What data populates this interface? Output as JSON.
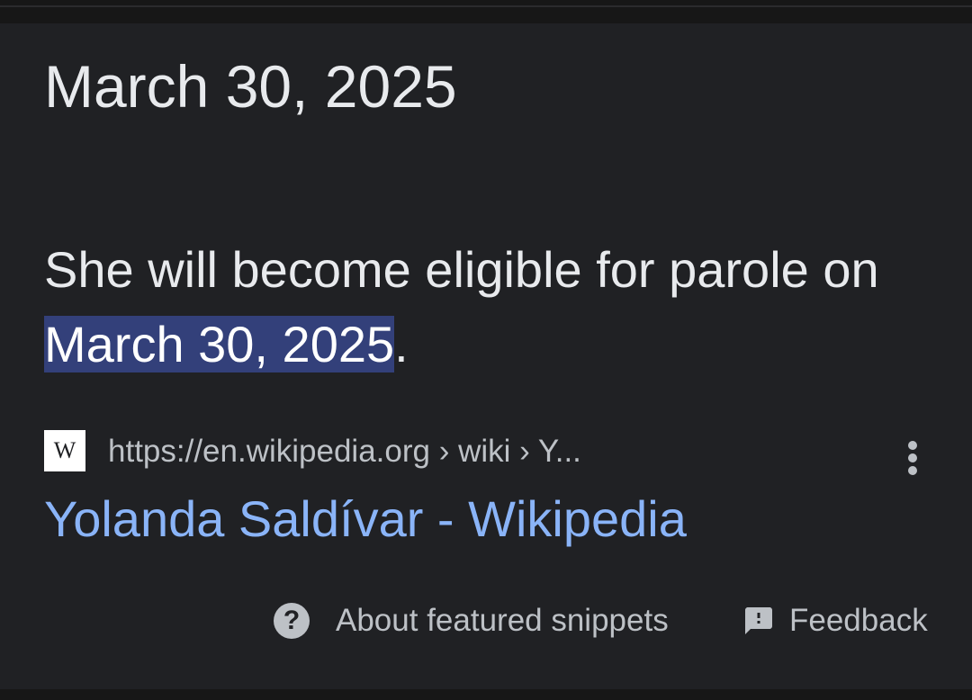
{
  "answer": {
    "date": "March 30, 2025"
  },
  "snippet": {
    "text_before": "She will become eligible for parole on ",
    "highlight": "March 30, 2025",
    "text_after": "."
  },
  "source": {
    "favicon_letter": "W",
    "url": "https://en.wikipedia.org › wiki › Y...",
    "title": "Yolanda Saldívar - Wikipedia"
  },
  "footer": {
    "about_label": "About featured snippets",
    "feedback_label": "Feedback"
  },
  "icons": {
    "help": "help-circle-icon",
    "feedback": "feedback-icon",
    "more": "more-vertical-icon"
  },
  "colors": {
    "card_background": "#202124",
    "highlight": "#33407a",
    "link": "#8ab4f8"
  }
}
